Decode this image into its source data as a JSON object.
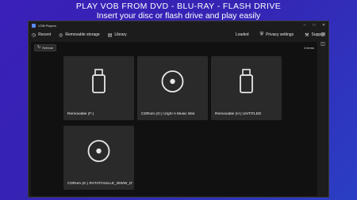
{
  "headline": {
    "line1": "PLAY VOB FROM DVD - BLU-RAY - FLASH DRIVE",
    "line2": "Insert your disc or flash drive and play easily"
  },
  "window": {
    "title": "VOB Players"
  },
  "nav": {
    "recent": "Recent",
    "removable": "Removable storage",
    "library": "Library",
    "status": "Loaded",
    "privacy": "Privacy settings",
    "support": "Support"
  },
  "toolbar": {
    "refresh": "Refresh",
    "count": "4 items"
  },
  "drives": [
    {
      "label": "Removable (F:)",
      "icon": "usb-drive-icon"
    },
    {
      "label": "CDRom (G:) Urgh! A Music War",
      "icon": "disc-icon"
    },
    {
      "label": "Removable (H:) UNTITLED",
      "icon": "usb-drive-icon"
    },
    {
      "label": "CDRom (K:) RATATOUILLE_WWW_DVD",
      "icon": "disc-icon"
    }
  ],
  "colors": {
    "background": "#3524b4",
    "window": "#1c1c1c",
    "tile": "#2a2a2a"
  }
}
